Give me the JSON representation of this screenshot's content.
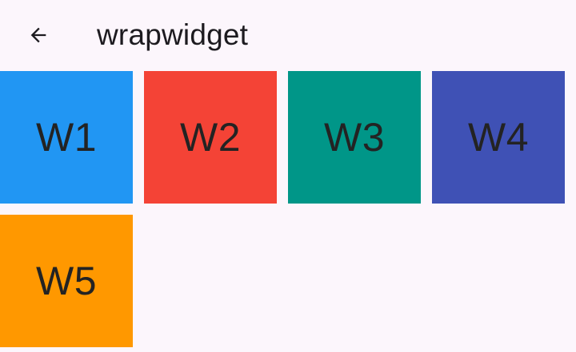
{
  "app_bar": {
    "title": "wrapwidget",
    "back_icon": "arrow-back-icon"
  },
  "tiles": [
    {
      "label": "W1",
      "color": "#2196f3"
    },
    {
      "label": "W2",
      "color": "#f44336"
    },
    {
      "label": "W3",
      "color": "#009688"
    },
    {
      "label": "W4",
      "color": "#3f51b5"
    },
    {
      "label": "W5",
      "color": "#ff9800"
    }
  ]
}
